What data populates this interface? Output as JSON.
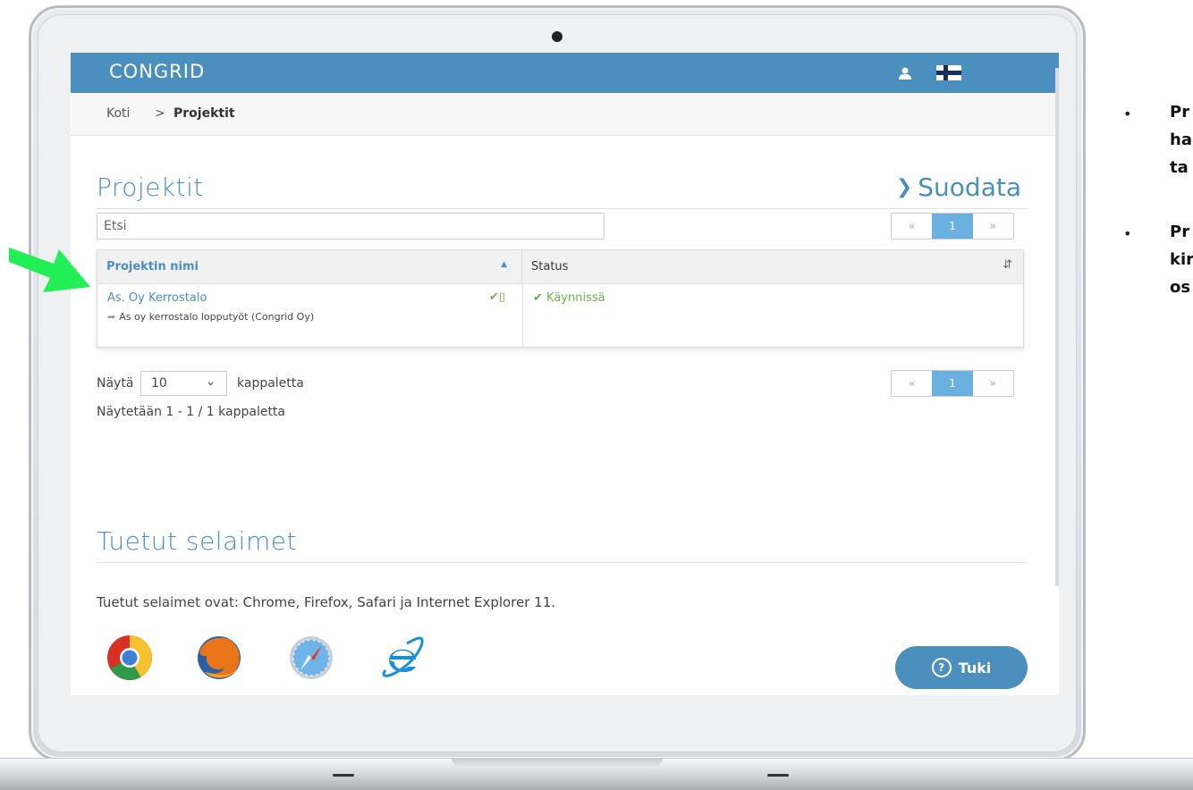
{
  "app": {
    "logo_text": "CONGRID",
    "brand_color": "#4a8fbd",
    "accent_green": "#6cb04e"
  },
  "header": {
    "user_icon": "user-icon",
    "language_flag": "finland-flag-icon"
  },
  "breadcrumb": {
    "home": "Koti",
    "separator": ">",
    "current": "Projektit"
  },
  "page": {
    "title": "Projektit",
    "filter_label": "Suodata",
    "filter_icon": "chevron-down-icon"
  },
  "search": {
    "placeholder": "Etsi"
  },
  "pagination": {
    "prev": "«",
    "current_page": "1",
    "next": "»"
  },
  "table": {
    "columns": [
      {
        "label": "Projektin nimi",
        "sort": "ascending"
      },
      {
        "label": "Status",
        "sort": "both"
      }
    ],
    "rows": [
      {
        "name": "As. Oy Kerrostalo",
        "subtitle": "As oy kerrostalo lopputyöt (Congrid Oy)",
        "status": "Käynnissä"
      }
    ]
  },
  "page_size": {
    "label": "Näytä",
    "value": "10",
    "unit": "kappaletta"
  },
  "showing_text": "Näytetään 1 - 1 / 1 kappaletta",
  "browsers": {
    "title": "Tuetut selaimet",
    "text": "Tuetut selaimet ovat: Chrome, Firefox, Safari ja Internet Explorer 11.",
    "icons": [
      "chrome-icon",
      "firefox-icon",
      "safari-icon",
      "internet-explorer-icon"
    ]
  },
  "help_button": {
    "label": "Tuki",
    "icon": "question-circle-icon"
  },
  "side_notes": [
    "Pr",
    "ha",
    "ta",
    "Pr",
    "kir",
    "os"
  ]
}
